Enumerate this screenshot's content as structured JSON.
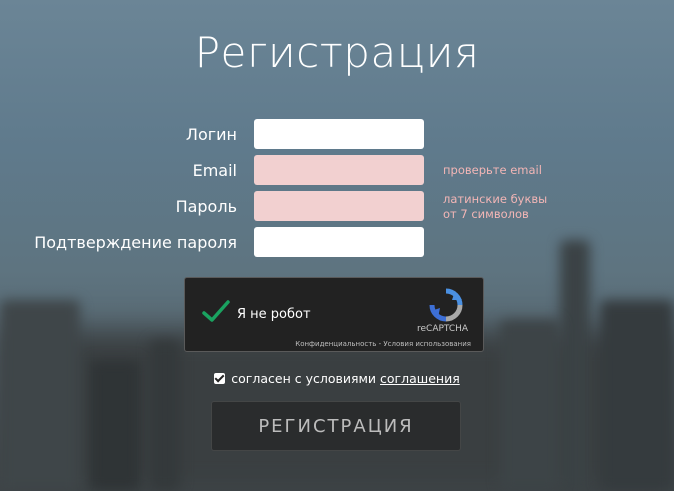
{
  "title": "Регистрация",
  "form": {
    "login": {
      "label": "Логин",
      "value": ""
    },
    "email": {
      "label": "Email",
      "value": "",
      "error_hint": "проверьте email"
    },
    "password": {
      "label": "Пароль",
      "value": "",
      "error_hint_line1": "латинские буквы",
      "error_hint_line2": "от 7 символов"
    },
    "confirm": {
      "label": "Подтверждение пароля",
      "value": ""
    }
  },
  "captcha": {
    "text": "Я не робот",
    "brand": "reCAPTCHA",
    "links": "Конфиденциальность - Условия использования"
  },
  "agreement": {
    "checked": true,
    "text": "согласен с условиями",
    "link": "соглашения"
  },
  "submit_label": "РЕГИСТРАЦИЯ",
  "colors": {
    "error_field": "#f2d0d0",
    "error_text": "#f3b6b6",
    "captcha_check": "#1aa260"
  }
}
